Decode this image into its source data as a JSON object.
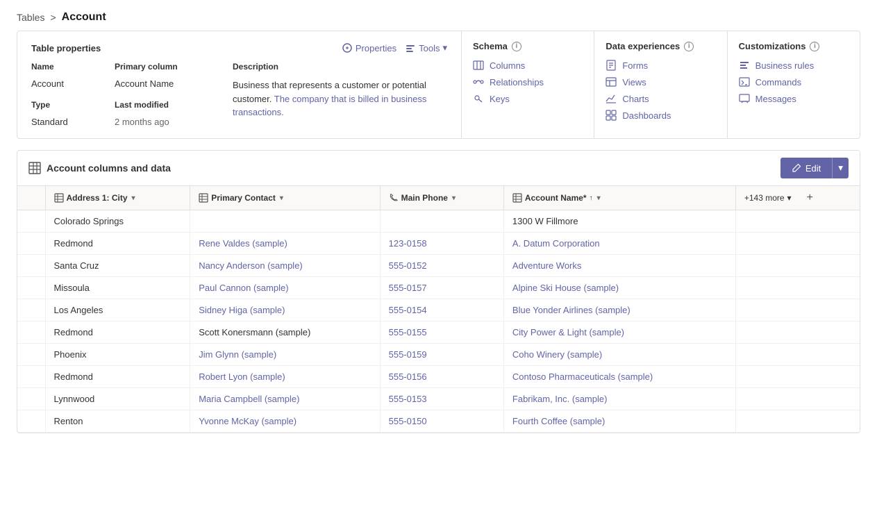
{
  "breadcrumb": {
    "parent": "Tables",
    "separator": ">",
    "current": "Account"
  },
  "tableProps": {
    "title": "Table properties",
    "actionsProperties": "Properties",
    "actionsTools": "Tools",
    "cols": {
      "nameLabel": "Name",
      "nameValue": "Account",
      "primaryColLabel": "Primary column",
      "primaryColValue": "Account Name",
      "typeLabel": "Type",
      "typeValue": "Standard",
      "lastModifiedLabel": "Last modified",
      "lastModifiedValue": "2 months ago",
      "descriptionLabel": "Description",
      "descriptionText1": "Business that represents a customer or potential customer.",
      "descriptionLink": "The company that is billed in business transactions.",
      "descriptionText2": ""
    }
  },
  "schema": {
    "title": "Schema",
    "links": [
      {
        "label": "Columns",
        "icon": "columns"
      },
      {
        "label": "Relationships",
        "icon": "relationships"
      },
      {
        "label": "Keys",
        "icon": "keys"
      }
    ]
  },
  "dataExperiences": {
    "title": "Data experiences",
    "links": [
      {
        "label": "Forms",
        "icon": "forms"
      },
      {
        "label": "Views",
        "icon": "views"
      },
      {
        "label": "Charts",
        "icon": "charts"
      },
      {
        "label": "Dashboards",
        "icon": "dashboards"
      }
    ]
  },
  "customizations": {
    "title": "Customizations",
    "links": [
      {
        "label": "Business rules",
        "icon": "business-rules"
      },
      {
        "label": "Commands",
        "icon": "commands"
      },
      {
        "label": "Messages",
        "icon": "messages"
      }
    ]
  },
  "dataSection": {
    "title": "Account columns and data",
    "editLabel": "Edit",
    "columns": [
      {
        "label": "Address 1: City",
        "icon": "col",
        "sortable": true
      },
      {
        "label": "Primary Contact",
        "icon": "col",
        "sortable": true
      },
      {
        "label": "Main Phone",
        "icon": "phone",
        "sortable": true
      },
      {
        "label": "Account Name",
        "icon": "col",
        "sortable": true,
        "required": true,
        "sorted": true
      }
    ],
    "moreColumns": "+143 more",
    "rows": [
      {
        "city": "Colorado Springs",
        "contact": "",
        "phone": "",
        "accountName": "1300 W Fillmore",
        "contactIsLink": false,
        "accountIsLink": false
      },
      {
        "city": "Redmond",
        "contact": "Rene Valdes (sample)",
        "phone": "123-0158",
        "accountName": "A. Datum Corporation",
        "contactIsLink": true,
        "accountIsLink": true
      },
      {
        "city": "Santa Cruz",
        "contact": "Nancy Anderson (sample)",
        "phone": "555-0152",
        "accountName": "Adventure Works",
        "contactIsLink": true,
        "accountIsLink": true
      },
      {
        "city": "Missoula",
        "contact": "Paul Cannon (sample)",
        "phone": "555-0157",
        "accountName": "Alpine Ski House (sample)",
        "contactIsLink": true,
        "accountIsLink": true
      },
      {
        "city": "Los Angeles",
        "contact": "Sidney Higa (sample)",
        "phone": "555-0154",
        "accountName": "Blue Yonder Airlines (sample)",
        "contactIsLink": true,
        "accountIsLink": true
      },
      {
        "city": "Redmond",
        "contact": "Scott Konersmann (sample)",
        "phone": "555-0155",
        "accountName": "City Power & Light (sample)",
        "contactIsLink": false,
        "accountIsLink": true
      },
      {
        "city": "Phoenix",
        "contact": "Jim Glynn (sample)",
        "phone": "555-0159",
        "accountName": "Coho Winery (sample)",
        "contactIsLink": true,
        "accountIsLink": true
      },
      {
        "city": "Redmond",
        "contact": "Robert Lyon (sample)",
        "phone": "555-0156",
        "accountName": "Contoso Pharmaceuticals (sample)",
        "contactIsLink": true,
        "accountIsLink": true
      },
      {
        "city": "Lynnwood",
        "contact": "Maria Campbell (sample)",
        "phone": "555-0153",
        "accountName": "Fabrikam, Inc. (sample)",
        "contactIsLink": true,
        "accountIsLink": true
      },
      {
        "city": "Renton",
        "contact": "Yvonne McKay (sample)",
        "phone": "555-0150",
        "accountName": "Fourth Coffee (sample)",
        "contactIsLink": true,
        "accountIsLink": true
      }
    ]
  }
}
